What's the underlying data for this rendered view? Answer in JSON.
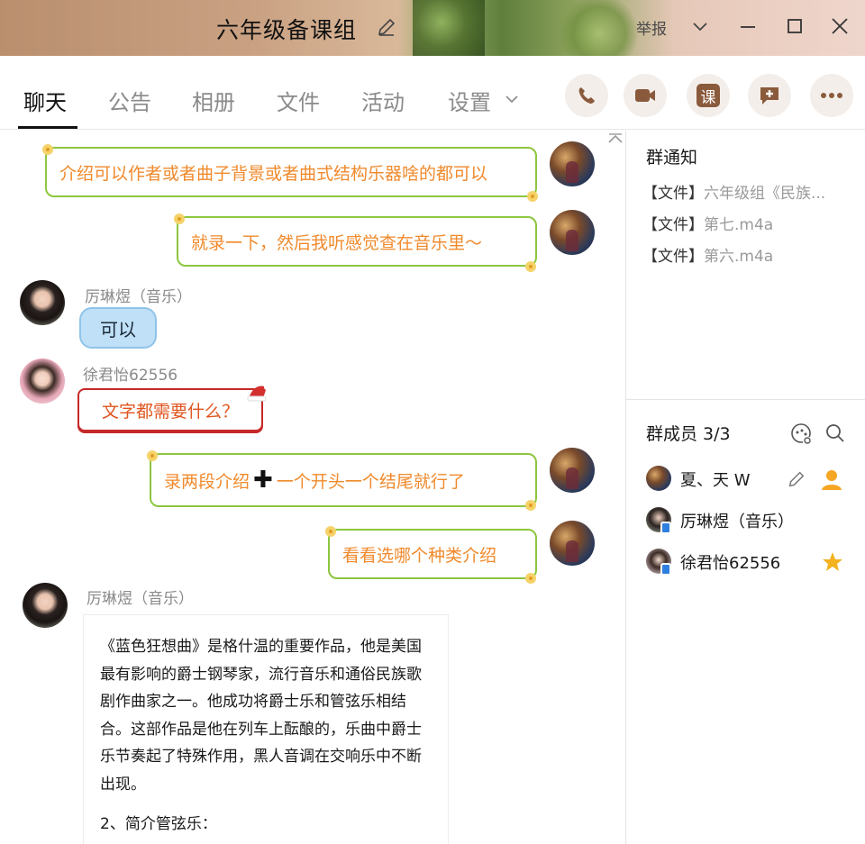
{
  "window": {
    "title": "六年级备课组",
    "report_label": "举报"
  },
  "tabs": [
    {
      "label": "聊天",
      "active": true
    },
    {
      "label": "公告"
    },
    {
      "label": "相册"
    },
    {
      "label": "文件"
    },
    {
      "label": "活动"
    },
    {
      "label": "设置"
    }
  ],
  "toolbar": {
    "lesson_label": "课"
  },
  "messages": [
    {
      "sender": "",
      "self": true,
      "text": "介绍可以作者或者曲子背景或者曲式结构乐器啥的都可以"
    },
    {
      "sender": "",
      "self": true,
      "text": "就录一下，然后我听感觉查在音乐里～"
    },
    {
      "sender": "厉琳煜（音乐）",
      "self": false,
      "text": "可以"
    },
    {
      "sender": "徐君怡62556",
      "self": false,
      "text": "文字都需要什么？"
    },
    {
      "sender": "",
      "self": true,
      "text_before": "录两段介绍",
      "text_after": "一个开头一个结尾就行了"
    },
    {
      "sender": "",
      "self": true,
      "text": "看看选哪个种类介绍"
    },
    {
      "sender": "厉琳煜（音乐）",
      "self": false,
      "doc": {
        "paragraph1": "《蓝色狂想曲》是格什温的重要作品，他是美国最有影响的爵士钢琴家，流行音乐和通俗民族歌剧作曲家之一。他成功将爵士乐和管弦乐相结合。这部作品是他在列车上酝酿的，乐曲中爵士乐节奏起了特殊作用，黑人音调在交响乐中不断出现。",
        "paragraph2": "2、简介管弦乐："
      }
    }
  ],
  "sidebar": {
    "notice_heading": "群通知",
    "notices": [
      {
        "tag": "【文件】",
        "name": "六年级组《民族..."
      },
      {
        "tag": "【文件】",
        "name": "第七.m4a"
      },
      {
        "tag": "【文件】",
        "name": "第六.m4a"
      }
    ],
    "members_heading": "群成员 3/3",
    "members": [
      {
        "name": "夏、天 W"
      },
      {
        "name": "厉琳煜（音乐）"
      },
      {
        "name": "徐君怡62556"
      }
    ]
  },
  "colors": {
    "accent": "#8a5a3c",
    "bubble_border": "#8dc63f",
    "bubble_text": "#f08a2c"
  }
}
